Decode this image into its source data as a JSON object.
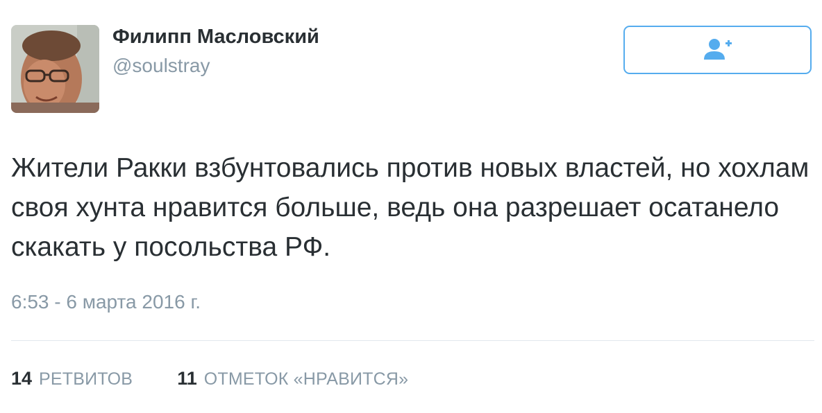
{
  "user": {
    "display_name": "Филипп Масловский",
    "handle": "@soulstray"
  },
  "follow_button": {
    "icon": "follow-user-plus-icon",
    "color": "#55acee"
  },
  "tweet": {
    "text": "Жители Ракки взбунтовались против новых властей, но хохлам своя хунта нравится больше, ведь она разрешает осатанело скакать у посольства РФ.",
    "timestamp": "6:53 - 6 марта 2016 г."
  },
  "stats": {
    "retweets_count": "14",
    "retweets_label": "РЕТВИТОВ",
    "likes_count": "11",
    "likes_label": "ОТМЕТОК «НРАВИТСЯ»"
  },
  "colors": {
    "text": "#292f33",
    "secondary": "#8899a6",
    "accent": "#55acee",
    "divider": "#e1e8ed"
  }
}
